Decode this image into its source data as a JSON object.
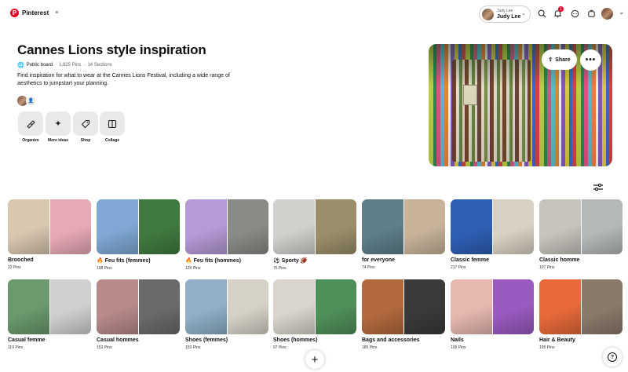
{
  "header": {
    "logo_text": "Pinterest",
    "account_small": "Judy Lee",
    "account_name": "Judy Lee",
    "notification_count": "1",
    "icons": [
      "search-icon",
      "bell-icon",
      "messages-icon",
      "updates-icon"
    ]
  },
  "board": {
    "title": "Cannes Lions style inspiration",
    "visibility": "Public board",
    "pins": "1,825 Pins",
    "sections_count": "14 Sections",
    "description": "Find inspiration for what to wear at the Cannes Lions Festival, including a wide range of aesthetics to jumpstart your planning."
  },
  "tools": [
    {
      "label": "Organize",
      "icon": "organize-icon"
    },
    {
      "label": "More ideas",
      "icon": "sparkle-icon"
    },
    {
      "label": "Shop",
      "icon": "tag-icon"
    },
    {
      "label": "Collage",
      "icon": "collage-icon"
    }
  ],
  "cover": {
    "share_label": "Share"
  },
  "sections": [
    {
      "title": "Brooched",
      "count": "22 Pins",
      "colors": [
        "#d9c7b0",
        "#e8a9b6"
      ]
    },
    {
      "title": "🔥 Feu fits (femmes)",
      "count": "198 Pins",
      "colors": [
        "#7fa8d4",
        "#3f7a3f"
      ]
    },
    {
      "title": "🔥 Feu fits (hommes)",
      "count": "125 Pins",
      "colors": [
        "#b59ad6",
        "#8a8a86"
      ]
    },
    {
      "title": "⚽ Sporty 🏈",
      "count": "75 Pins",
      "colors": [
        "#cfd2cc",
        "#9a8f6a"
      ]
    },
    {
      "title": "for everyone",
      "count": "74 Pins",
      "colors": [
        "#5f7f8a",
        "#c7b39a"
      ]
    },
    {
      "title": "Classic femme",
      "count": "217 Pins",
      "colors": [
        "#2f5fb5",
        "#d8d2c2"
      ]
    },
    {
      "title": "Classic homme",
      "count": "107 Pins",
      "colors": [
        "#c7c4bd",
        "#b4b8b8"
      ]
    },
    {
      "title": "Casual femme",
      "count": "119 Pins",
      "colors": [
        "#6a9a6e",
        "#cfcfcf"
      ]
    },
    {
      "title": "Casual hommes",
      "count": "153 Pins",
      "colors": [
        "#b88a8a",
        "#6a6a6a"
      ]
    },
    {
      "title": "Shoes (femmes)",
      "count": "153 Pins",
      "colors": [
        "#8fb0c8",
        "#d6d1c6"
      ]
    },
    {
      "title": "Shoes (hommes)",
      "count": "97 Pins",
      "colors": [
        "#d9d5cc",
        "#4f8f5a"
      ]
    },
    {
      "title": "Bags and accessories",
      "count": "185 Pins",
      "colors": [
        "#b46a3f",
        "#3a3a3a"
      ]
    },
    {
      "title": "Nails",
      "count": "105 Pins",
      "colors": [
        "#e6b8b0",
        "#9a5ac0"
      ]
    },
    {
      "title": "Hair & Beauty",
      "count": "195 Pins",
      "colors": [
        "#e86a3a",
        "#8a7a6a"
      ]
    }
  ]
}
